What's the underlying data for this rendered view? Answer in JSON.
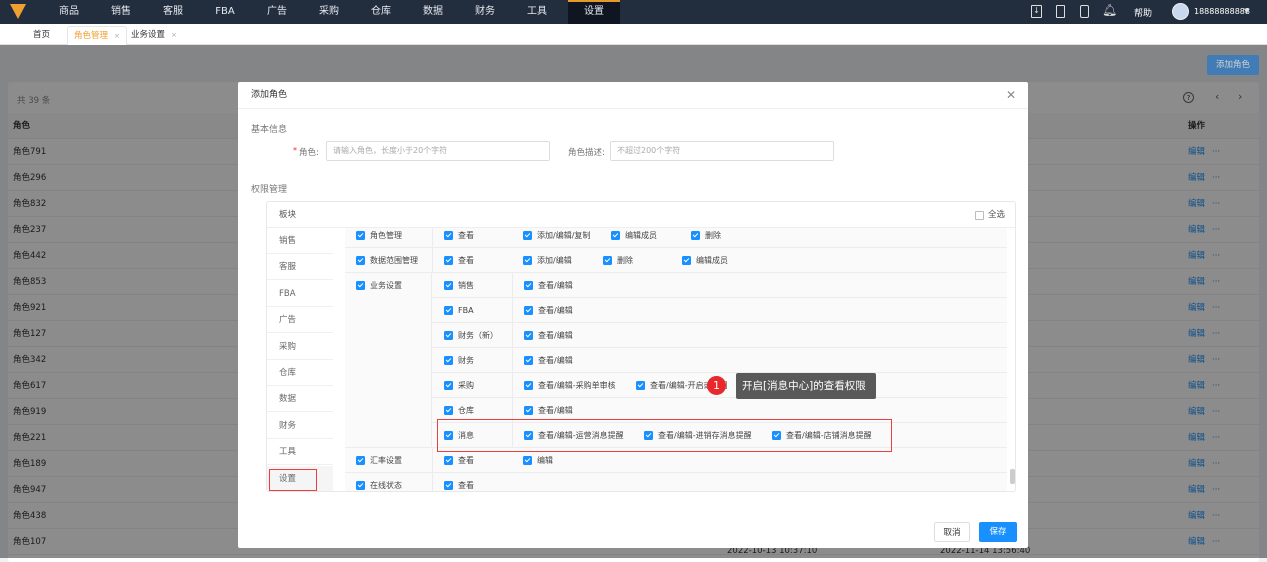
{
  "nav": {
    "items": [
      "商品",
      "销售",
      "客服",
      "FBA",
      "广告",
      "采购",
      "仓库",
      "数据",
      "财务",
      "工具",
      "设置"
    ],
    "active": "设置",
    "help": "帮助",
    "user": "18888888888",
    "colors": {
      "bg": "#222d3e",
      "accent": "#e39a2a"
    }
  },
  "tabs": [
    {
      "label": "首页"
    },
    {
      "label": "角色管理",
      "close": "×"
    },
    {
      "label": "业务设置",
      "close": "×"
    }
  ],
  "page": {
    "add_button": "添加角色",
    "total": "共 39 条",
    "col_role": "角色",
    "col_action": "操作",
    "edit": "编辑",
    "more": "···",
    "rows": [
      "角色791",
      "角色296",
      "角色832",
      "角色237",
      "角色442",
      "角色853",
      "角色921",
      "角色127",
      "角色342",
      "角色617",
      "角色919",
      "角色221",
      "角色189",
      "角色947",
      "角色438",
      "角色107"
    ],
    "last_dates": [
      "2022-10-13 10:37:10",
      "2022-11-14 13:56:40"
    ]
  },
  "modal": {
    "title": "添加角色",
    "basic_info": "基本信息",
    "role_label": "角色:",
    "role_required": "*",
    "role_placeholder": "请输入角色，长度小于20个字符",
    "desc_label": "角色描述:",
    "desc_placeholder": "不超过200个字符",
    "perm_title": "权限管理",
    "module_header": "板块",
    "select_all": "全选",
    "modules": [
      "销售",
      "客服",
      "FBA",
      "广告",
      "采购",
      "仓库",
      "数据",
      "财务",
      "工具",
      "设置"
    ],
    "selected_module": "设置",
    "groups": [
      {
        "name": "角色管理",
        "perms": [
          "查看",
          "添加/编辑/复制",
          "编辑成员",
          "删除"
        ]
      },
      {
        "name": "数据范围管理",
        "perms": [
          "查看",
          "添加/编辑",
          "删除",
          "编辑成员"
        ]
      },
      {
        "name": "业务设置",
        "subs": [
          {
            "name": "销售",
            "perms": [
              "查看/编辑"
            ]
          },
          {
            "name": "FBA",
            "perms": [
              "查看/编辑"
            ]
          },
          {
            "name": "财务（新）",
            "perms": [
              "查看/编辑"
            ]
          },
          {
            "name": "财务",
            "perms": [
              "查看/编辑"
            ]
          },
          {
            "name": "采购",
            "perms": [
              "查看/编辑-采购单审核",
              "查看/编辑-开启或关闭"
            ]
          },
          {
            "name": "仓库",
            "perms": [
              "查看/编辑"
            ]
          },
          {
            "name": "消息",
            "perms": [
              "查看/编辑-运营消息提醒",
              "查看/编辑-进销存消息提醒",
              "查看/编辑-店铺消息提醒"
            ]
          }
        ]
      },
      {
        "name": "汇率设置",
        "perms": [
          "查看",
          "编辑"
        ]
      },
      {
        "name": "在线状态",
        "perms": [
          "查看"
        ]
      }
    ],
    "cancel": "取消",
    "save": "保存"
  },
  "annotation": {
    "step": "1",
    "text": "开启[消息中心]的查看权限"
  }
}
